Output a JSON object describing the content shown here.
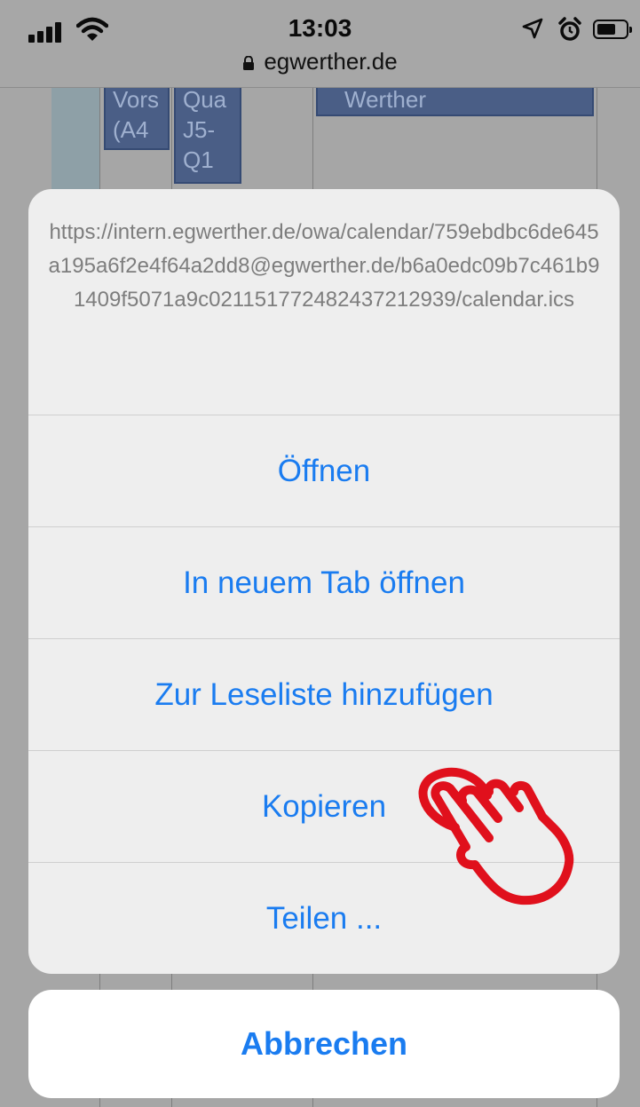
{
  "status_bar": {
    "time": "13:03",
    "domain": "egwerther.de"
  },
  "background_page": {
    "events": [
      {
        "text": "Vors\n(A4"
      },
      {
        "text": "Qua\nJ5-\nQ1"
      },
      {
        "text": "Werther"
      }
    ]
  },
  "action_sheet": {
    "url": "https://intern.egwerther.de/owa/calendar/759ebdbc6de645a195a6f2e4f64a2dd8@egwerther.de/b6a0edc09b7c461b91409f5071a9c021151772482437212939/calendar.ics",
    "actions": [
      {
        "label": "Öffnen"
      },
      {
        "label": "In neuem Tab öffnen"
      },
      {
        "label": "Zur Leseliste hinzufügen"
      },
      {
        "label": "Kopieren"
      },
      {
        "label": "Teilen ..."
      }
    ],
    "cancel_label": "Abbrechen"
  },
  "colors": {
    "accent": "#1a7cf0",
    "sheet_bg": "#eeeeee",
    "dim_bg": "#9a9a9a",
    "tap_indicator": "#e0101c"
  },
  "icons": [
    "signal-icon",
    "wifi-icon",
    "location-icon",
    "alarm-icon",
    "battery-icon",
    "lock-icon",
    "tap-hand-icon"
  ]
}
